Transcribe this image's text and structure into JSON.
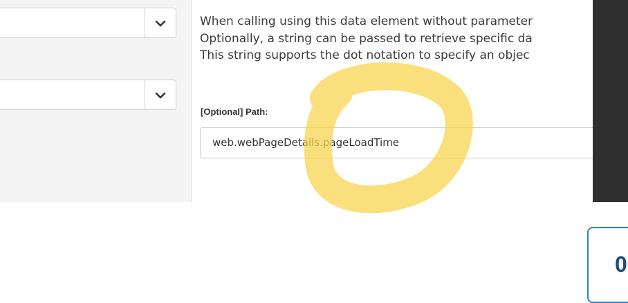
{
  "left_panel": {
    "selects": [
      {
        "value": ""
      },
      {
        "value": ""
      }
    ]
  },
  "description": {
    "lines": [
      "When calling using this data element without parameter",
      "Optionally, a string can be passed to retrieve specific da",
      "This string supports the dot notation to specify an objec"
    ]
  },
  "path_field": {
    "label": "[Optional] Path:",
    "value": "web.webPageDetails.pageLoadTime"
  },
  "bottom_card": {
    "text": "0"
  },
  "colors": {
    "highlight": "#f7d44a",
    "accent": "#2f80d1",
    "dark_bar": "#2f2f2f"
  },
  "icons": [
    "chevron-down-icon"
  ]
}
